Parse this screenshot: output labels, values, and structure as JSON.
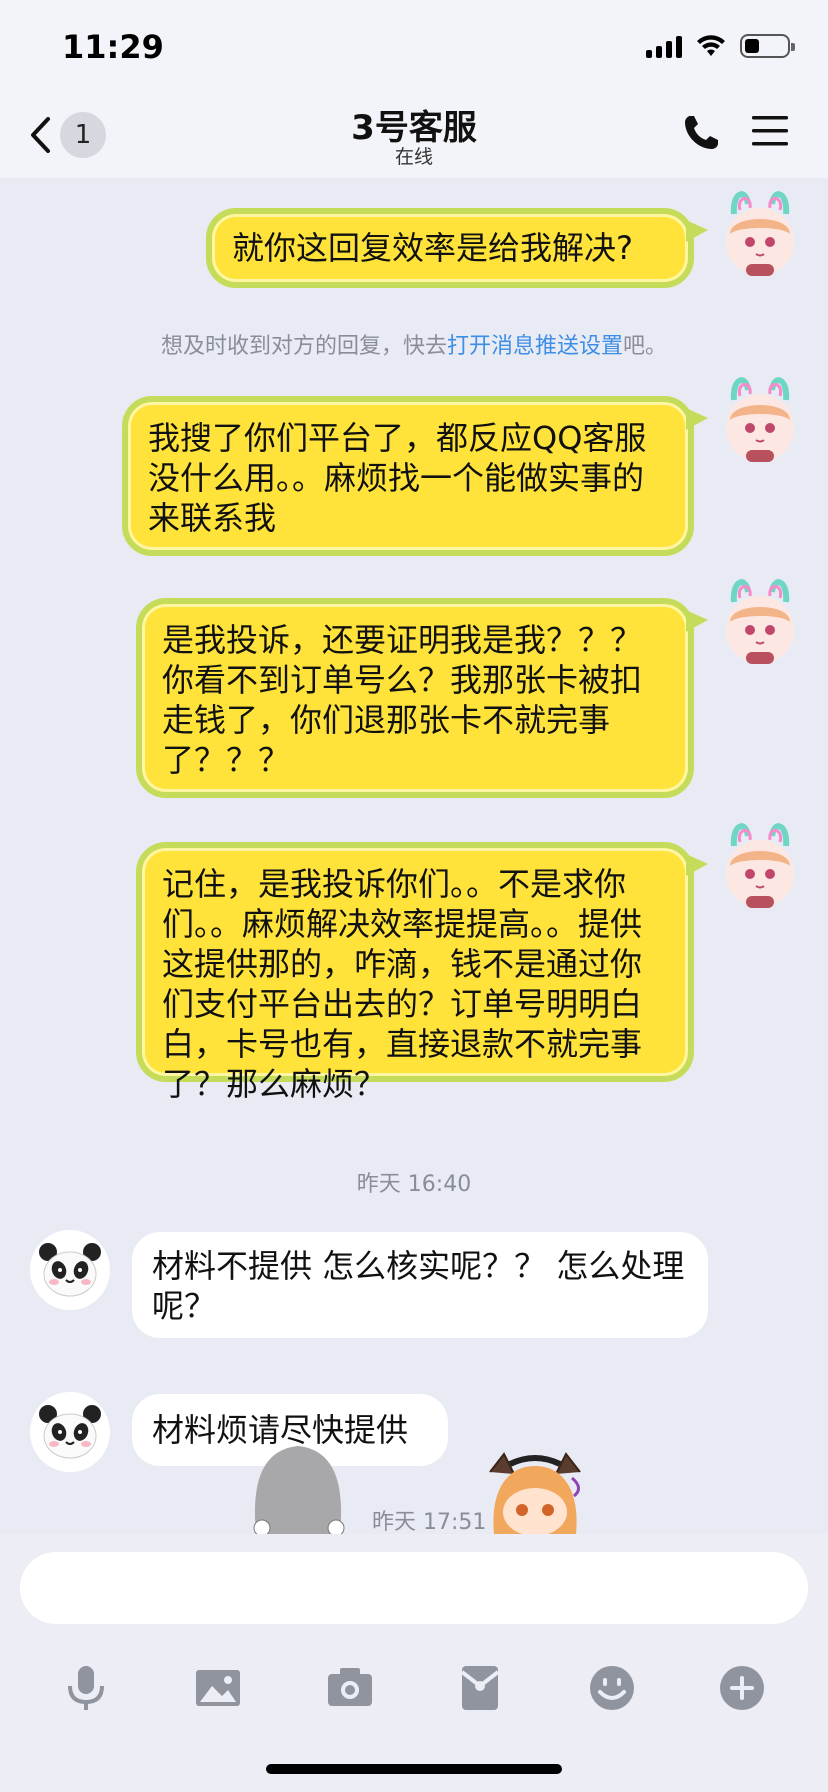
{
  "status_bar": {
    "time": "11:29"
  },
  "header": {
    "unread_count": "1",
    "title": "3号客服",
    "subtitle": "在线"
  },
  "messages": [
    {
      "side": "right",
      "text": "就你这回复效率是给我解决?"
    },
    {
      "side": "system",
      "text_before": "想及时收到对方的回复，快去",
      "link": "打开消息推送设置",
      "text_after": "吧。"
    },
    {
      "side": "right",
      "text": "我搜了你们平台了，都反应QQ客服没什么用。。麻烦找一个能做实事的来联系我"
    },
    {
      "side": "right",
      "text": "是我投诉，还要证明我是我？？？你看不到订单号么？我那张卡被扣走钱了，你们退那张卡不就完事了？？？"
    },
    {
      "side": "right",
      "text": "记住，是我投诉你们。。不是求你们。。麻烦解决效率提提高。。提供这提供那的，咋滴，钱不是通过你们支付平台出去的？订单号明明白白，卡号也有，直接退款不就完事了？那么麻烦？"
    },
    {
      "side": "timestamp",
      "text": "昨天 16:40"
    },
    {
      "side": "left",
      "text": "材料不提供  怎么核实呢？？ 怎么处理呢？"
    },
    {
      "side": "left",
      "text": "材料烦请尽快提供"
    },
    {
      "side": "timestamp",
      "text": "昨天 17:51"
    }
  ],
  "input_bar": {
    "tools": [
      "microphone-icon",
      "image-icon",
      "camera-icon",
      "red-packet-icon",
      "emoji-icon",
      "plus-icon"
    ]
  },
  "colors": {
    "background": "#e9ebf4",
    "my_bubble": "#ffe33a",
    "my_bubble_border": "#c5dc5b",
    "link": "#3d8ee6"
  }
}
